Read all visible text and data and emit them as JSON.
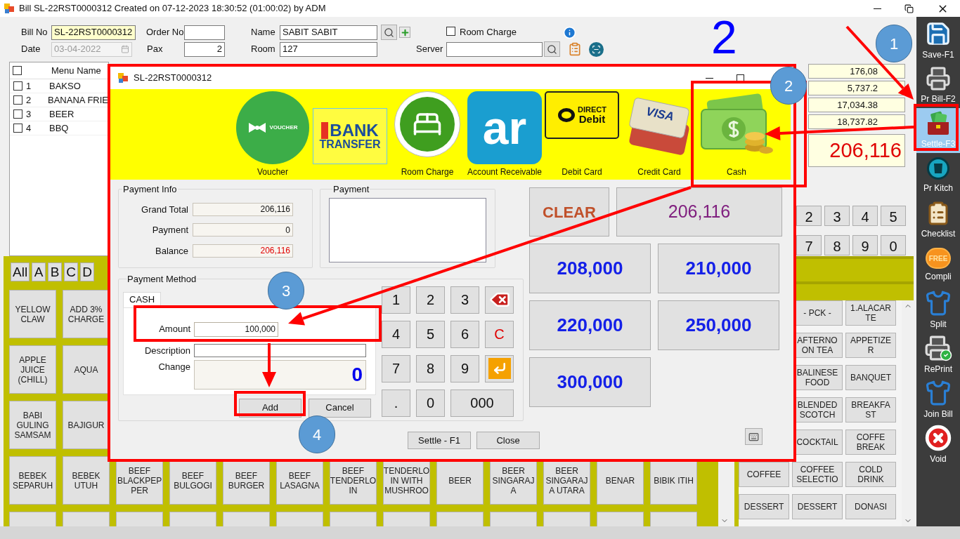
{
  "window": {
    "title": "Bill SL-22RST0000312 Created on 07-12-2023 18:30:52 (01:00:02) by ADM"
  },
  "header": {
    "bill_no": {
      "label": "Bill No",
      "value": "SL-22RST0000312"
    },
    "order_no": {
      "label": "Order No"
    },
    "name": {
      "label": "Name",
      "value": "SABIT SABIT"
    },
    "room_charge": {
      "label": "Room Charge",
      "checked": false
    },
    "date": {
      "label": "Date",
      "value": "03-04-2022",
      "disabled": true
    },
    "pax": {
      "label": "Pax",
      "value": "2"
    },
    "room": {
      "label": "Room",
      "value": "127"
    },
    "server": {
      "label": "Server"
    }
  },
  "order_list": {
    "header_checked": false,
    "columns": [
      "Menu Name"
    ],
    "rows": [
      {
        "number": "1",
        "name": "BAKSO",
        "checked": false
      },
      {
        "number": "2",
        "name": "BANANA FRIE",
        "checked": false
      },
      {
        "number": "3",
        "name": "BEER",
        "checked": false
      },
      {
        "number": "4",
        "name": "BBQ",
        "checked": false
      }
    ]
  },
  "totals": {
    "rows": [
      "176,08",
      "5,737.2",
      "17,034.38",
      "18,737.82"
    ],
    "grand_total": "206,116"
  },
  "keypad": [
    "2",
    "3",
    "4",
    "5",
    "7",
    "8",
    "9",
    "0"
  ],
  "menu_tabs": [
    "All",
    "A",
    "B",
    "C",
    "D"
  ],
  "menu_grid": {
    "rows": [
      [
        "YELLOW CLAW",
        "ADD 3% CHARGE"
      ],
      [
        "APPLE JUICE (CHILL)",
        "AQUA"
      ],
      [
        "BABI GULING SAMSAM",
        "BAJIGUR"
      ],
      [
        "BEBEK SEPARUH",
        "BEBEK UTUH",
        "BEEF BLACKPEP PER",
        "BEEF BULGOGI",
        "BEEF BURGER",
        "BEEF LASAGNA",
        "BEEF TENDERLO IN",
        "TENDERLO IN WITH MUSHROO",
        "BEER",
        "BEER SINGARAJ A",
        "BEER SINGARAJ A UTARA",
        "BENAR",
        "BIBIK ITIH"
      ]
    ]
  },
  "category_menu": {
    "rows": [
      [
        "- PCK -",
        "1.ALACAR TE"
      ],
      [
        "AFTERNO ON TEA",
        "APPETIZE R"
      ],
      [
        "BALINESE FOOD",
        "BANQUET"
      ],
      [
        "BLENDED SCOTCH",
        "BREAKFA ST"
      ],
      [
        "COCKTAIL",
        "COFFE BREAK"
      ],
      [
        "COFFEE",
        "COFFEE SELECTIO",
        "COLD DRINK"
      ],
      [
        "DESSERT",
        "DESSERT",
        "DONASI"
      ]
    ]
  },
  "sidebar": {
    "items": [
      {
        "kind": "save",
        "label": "Save-F1",
        "selected": false
      },
      {
        "kind": "print_bill",
        "label": "Pr Bill-F2",
        "selected": false
      },
      {
        "kind": "settle",
        "label": "Settle-F3",
        "selected": true
      },
      {
        "kind": "print_kitchen",
        "label": "Pr Kitch",
        "selected": false
      },
      {
        "kind": "checklist",
        "label": "Checklist",
        "selected": false
      },
      {
        "kind": "compli",
        "label": "Compli",
        "badge": "FREE",
        "selected": false
      },
      {
        "kind": "split",
        "label": "Split",
        "selected": false
      },
      {
        "kind": "reprint",
        "label": "RePrint",
        "selected": false
      },
      {
        "kind": "join",
        "label": "Join Bill",
        "selected": false
      },
      {
        "kind": "void",
        "label": "Void",
        "selected": false
      }
    ]
  },
  "dialog": {
    "title": "SL-22RST0000312",
    "payment_types": [
      {
        "kind": "voucher",
        "label": "Voucher",
        "logo_lines": [
          "VOUCHER"
        ]
      },
      {
        "kind": "bank_transfer",
        "logo_lines": [
          "BANK",
          "TRANSFER"
        ]
      },
      {
        "kind": "room_charge",
        "label": "Room Charge"
      },
      {
        "kind": "account_receivable",
        "label": "Account Receivable",
        "logo_lines": [
          "ar"
        ]
      },
      {
        "kind": "debit_card",
        "label": "Debit Card",
        "logo_lines": [
          "DIRECT",
          "Debit"
        ]
      },
      {
        "kind": "credit_card",
        "label": "Credit Card",
        "logo_lines": [
          "VISA"
        ]
      },
      {
        "kind": "cash",
        "label": "Cash"
      }
    ],
    "payment_info": {
      "title": "Payment Info",
      "rows": [
        {
          "label": "Grand Total",
          "value": "206,116",
          "kind": "normal"
        },
        {
          "label": "Payment",
          "value": "0",
          "kind": "normal"
        },
        {
          "label": "Balance",
          "value": "206,116",
          "kind": "alert"
        }
      ]
    },
    "payment": {
      "title": "Payment"
    },
    "payment_method": {
      "title": "Payment Method",
      "tabs": [
        {
          "label": "CASH",
          "selected": true
        }
      ],
      "amount": {
        "label": "Amount",
        "value": "100,000"
      },
      "description": {
        "label": "Description"
      },
      "change": {
        "label": "Change",
        "value": "0"
      },
      "buttons": [
        "Add",
        "Cancel"
      ]
    },
    "numpad": [
      {
        "kind": "key",
        "label": "1"
      },
      {
        "kind": "key",
        "label": "2"
      },
      {
        "kind": "key",
        "label": "3"
      },
      {
        "kind": "backspace"
      },
      {
        "kind": "key",
        "label": "4"
      },
      {
        "kind": "key",
        "label": "5"
      },
      {
        "kind": "key",
        "label": "6"
      },
      {
        "kind": "clear",
        "label": "C"
      },
      {
        "kind": "key",
        "label": "7"
      },
      {
        "kind": "key",
        "label": "8"
      },
      {
        "kind": "key",
        "label": "9"
      },
      {
        "kind": "enter"
      },
      {
        "kind": "key",
        "label": "."
      },
      {
        "kind": "key",
        "label": "0"
      },
      {
        "kind": "wide",
        "label": "000"
      }
    ],
    "clear_button": "CLEAR",
    "total_button": "206,116",
    "quick_amounts": [
      "208,000",
      "210,000",
      "220,000",
      "250,000",
      "300,000"
    ],
    "footer_buttons": [
      "Settle - F1",
      "Close"
    ]
  },
  "annotations": {
    "big_number": "2",
    "markers": [
      "1",
      "2",
      "3",
      "4"
    ]
  }
}
